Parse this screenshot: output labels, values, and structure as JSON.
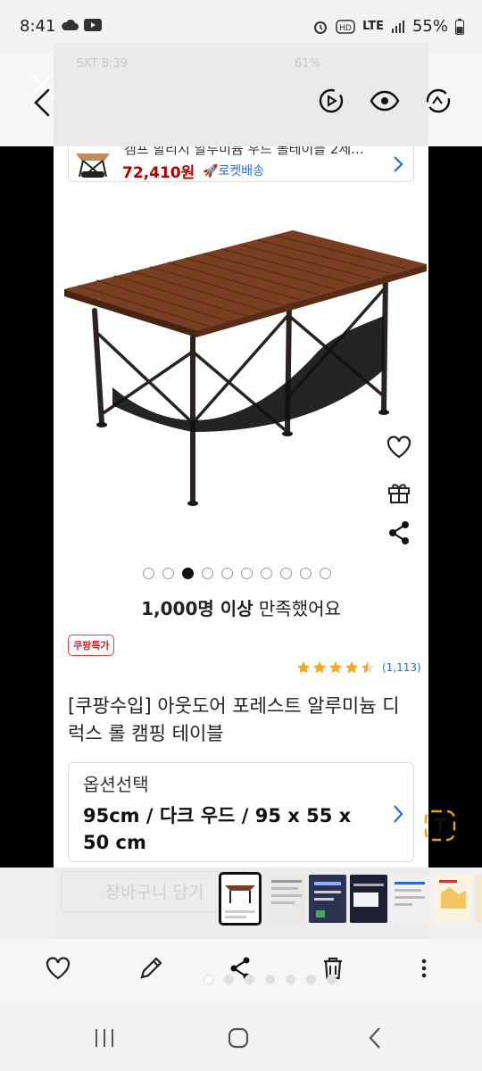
{
  "status_bar": {
    "time": "8:41",
    "network": "LTE",
    "battery": "55%"
  },
  "ghost_overlay": {
    "carrier_text": "SKT 8:39",
    "battery_text": "61%",
    "cart_button": "장바구니 담기"
  },
  "related": {
    "title": "캠프 할리지 알루미늄 우드 롤테이블 2세...",
    "price": "72,410원",
    "delivery": "로켓배송"
  },
  "gallery": {
    "dot_count": 10,
    "active_index": 2
  },
  "satisfaction": {
    "bold": "1,000명 이상",
    "rest": " 만족했어요"
  },
  "badge": "쿠팡특가",
  "rating": {
    "stars": 4.5,
    "count": "(1,113)"
  },
  "product_title": "[쿠팡수입] 아웃도어 포레스트 알루미늄 디럭스 롤 캠핑 테이블",
  "option": {
    "label": "옵션선택",
    "value": "95cm / 다크 우드 / 95 x 55 x 50 cm"
  },
  "colors": {
    "price_red": "#ae0000",
    "link_blue": "#1f6fd6",
    "star_yellow": "#f5a623"
  },
  "icons": [
    "close-icon",
    "back-icon",
    "motion-photo-icon",
    "eye-icon",
    "remaster-icon",
    "heart-icon",
    "gift-icon",
    "share-icon",
    "text-extract-icon",
    "favorite-icon",
    "edit-icon",
    "share-icon",
    "delete-icon",
    "more-icon",
    "recent-apps-icon",
    "home-icon",
    "back-nav-icon"
  ]
}
